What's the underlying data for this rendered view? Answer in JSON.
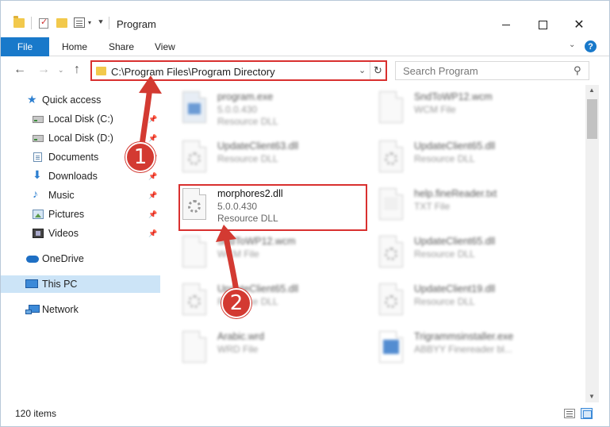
{
  "window": {
    "title": "Program"
  },
  "ribbon": {
    "tabs": [
      "File",
      "Home",
      "Share",
      "View"
    ]
  },
  "nav": {
    "address": "C:\\Program Files\\Program Directory",
    "search_placeholder": "Search Program"
  },
  "sidebar": {
    "items": [
      {
        "label": "Quick access"
      },
      {
        "label": "Local Disk (C:)"
      },
      {
        "label": "Local Disk (D:)"
      },
      {
        "label": "Documents"
      },
      {
        "label": "Downloads"
      },
      {
        "label": "Music"
      },
      {
        "label": "Pictures"
      },
      {
        "label": "Videos"
      },
      {
        "label": "OneDrive"
      },
      {
        "label": "This PC"
      },
      {
        "label": "Network"
      }
    ]
  },
  "files": [
    {
      "name": "program.exe",
      "meta1": "5.0.0.430",
      "meta2": "Resource DLL"
    },
    {
      "name": "SndToWP12.wcm",
      "meta1": "WCM File",
      "meta2": ""
    },
    {
      "name": "UpdateClient63.dll",
      "meta1": "Resource DLL",
      "meta2": ""
    },
    {
      "name": "UpdateClient65.dll",
      "meta1": "Resource DLL",
      "meta2": ""
    },
    {
      "name": "morphores2.dll",
      "meta1": "5.0.0.430",
      "meta2": "Resource DLL"
    },
    {
      "name": "help.fineReader.txt",
      "meta1": "TXT File",
      "meta2": ""
    },
    {
      "name": "SndToWP12.wcm",
      "meta1": "WCM File",
      "meta2": ""
    },
    {
      "name": "UpdateClient65.dll",
      "meta1": "Resource DLL",
      "meta2": ""
    },
    {
      "name": "UpdateClient65.dll",
      "meta1": "Resource DLL",
      "meta2": ""
    },
    {
      "name": "UpdateClient19.dll",
      "meta1": "Resource DLL",
      "meta2": ""
    },
    {
      "name": "Arabic.wrd",
      "meta1": "WRD File",
      "meta2": ""
    },
    {
      "name": "Trigrammsinstaller.exe",
      "meta1": "ABBYY Finereader bl...",
      "meta2": ""
    }
  ],
  "status": {
    "item_count": "120 items"
  },
  "callouts": [
    "1",
    "2"
  ],
  "colors": {
    "accent": "#1979ca",
    "highlight": "#d9302f",
    "selected": "#cce4f7"
  }
}
